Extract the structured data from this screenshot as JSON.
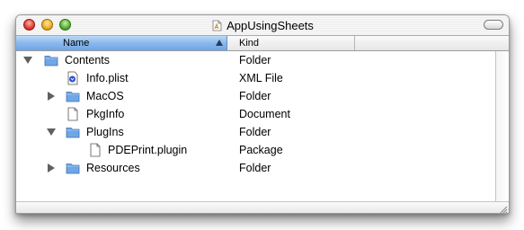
{
  "window": {
    "title": "AppUsingSheets",
    "title_icon": "app-document-icon"
  },
  "columns": {
    "name": "Name",
    "kind": "Kind",
    "sorted_by": "name",
    "sort_direction": "ascending"
  },
  "rows": [
    {
      "name": "Contents",
      "kind": "Folder",
      "icon": "folder-icon",
      "disclosure": "expanded",
      "depth": 0
    },
    {
      "name": "Info.plist",
      "kind": "XML File",
      "icon": "xml-file-icon",
      "disclosure": "none",
      "depth": 1
    },
    {
      "name": "MacOS",
      "kind": "Folder",
      "icon": "folder-icon",
      "disclosure": "collapsed",
      "depth": 1
    },
    {
      "name": "PkgInfo",
      "kind": "Document",
      "icon": "document-icon",
      "disclosure": "none",
      "depth": 1
    },
    {
      "name": "PlugIns",
      "kind": "Folder",
      "icon": "folder-icon",
      "disclosure": "expanded",
      "depth": 1
    },
    {
      "name": "PDEPrint.plugin",
      "kind": "Package",
      "icon": "document-icon",
      "disclosure": "none",
      "depth": 2
    },
    {
      "name": "Resources",
      "kind": "Folder",
      "icon": "folder-icon",
      "disclosure": "collapsed",
      "depth": 1
    }
  ],
  "colors": {
    "selected_column_header": "#8ab8ee",
    "folder": "#6fa6e6",
    "close_button": "#e3463c",
    "minimize_button": "#f1b22a",
    "zoom_button": "#5fb43a"
  }
}
